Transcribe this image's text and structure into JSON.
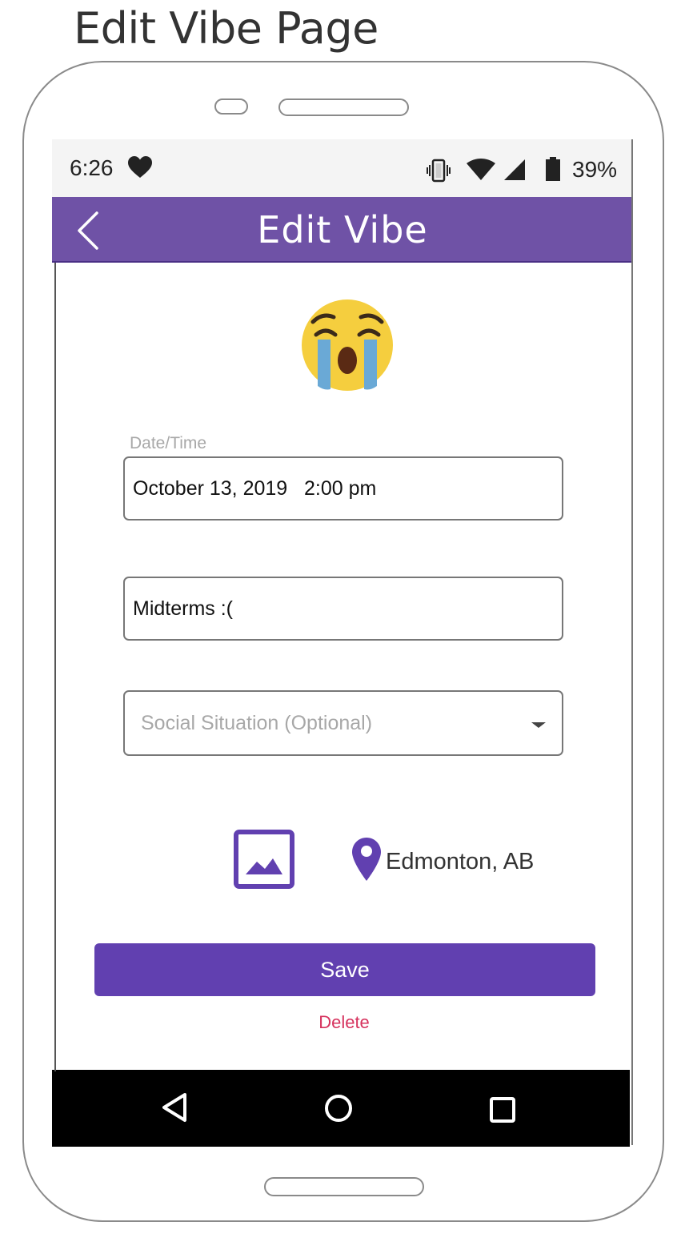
{
  "page_heading": "Edit Vibe Page",
  "status_bar": {
    "time": "6:26",
    "battery": "39%",
    "icons": [
      "heart-icon",
      "vibrate-icon",
      "wifi-icon",
      "signal-icon",
      "battery-icon"
    ]
  },
  "app_bar": {
    "title": "Edit Vibe",
    "back_icon": "chevron-left-icon",
    "color": "#6f52a6"
  },
  "mood": {
    "emoji_icon": "crying-face-icon"
  },
  "form": {
    "datetime": {
      "label": "Date/Time",
      "value": "October 13, 2019   2:00 pm"
    },
    "reason": {
      "value": "Midterms :("
    },
    "social_situation": {
      "placeholder": "Social Situation (Optional)"
    },
    "image_icon": "image-icon",
    "location": {
      "icon": "location-pin-icon",
      "value": "Edmonton, AB"
    }
  },
  "actions": {
    "save_label": "Save",
    "delete_label": "Delete",
    "save_color": "#6140b0",
    "delete_color": "#d6335e"
  },
  "nav_bar": {
    "icons": [
      "nav-back-icon",
      "nav-home-icon",
      "nav-recents-icon"
    ]
  }
}
